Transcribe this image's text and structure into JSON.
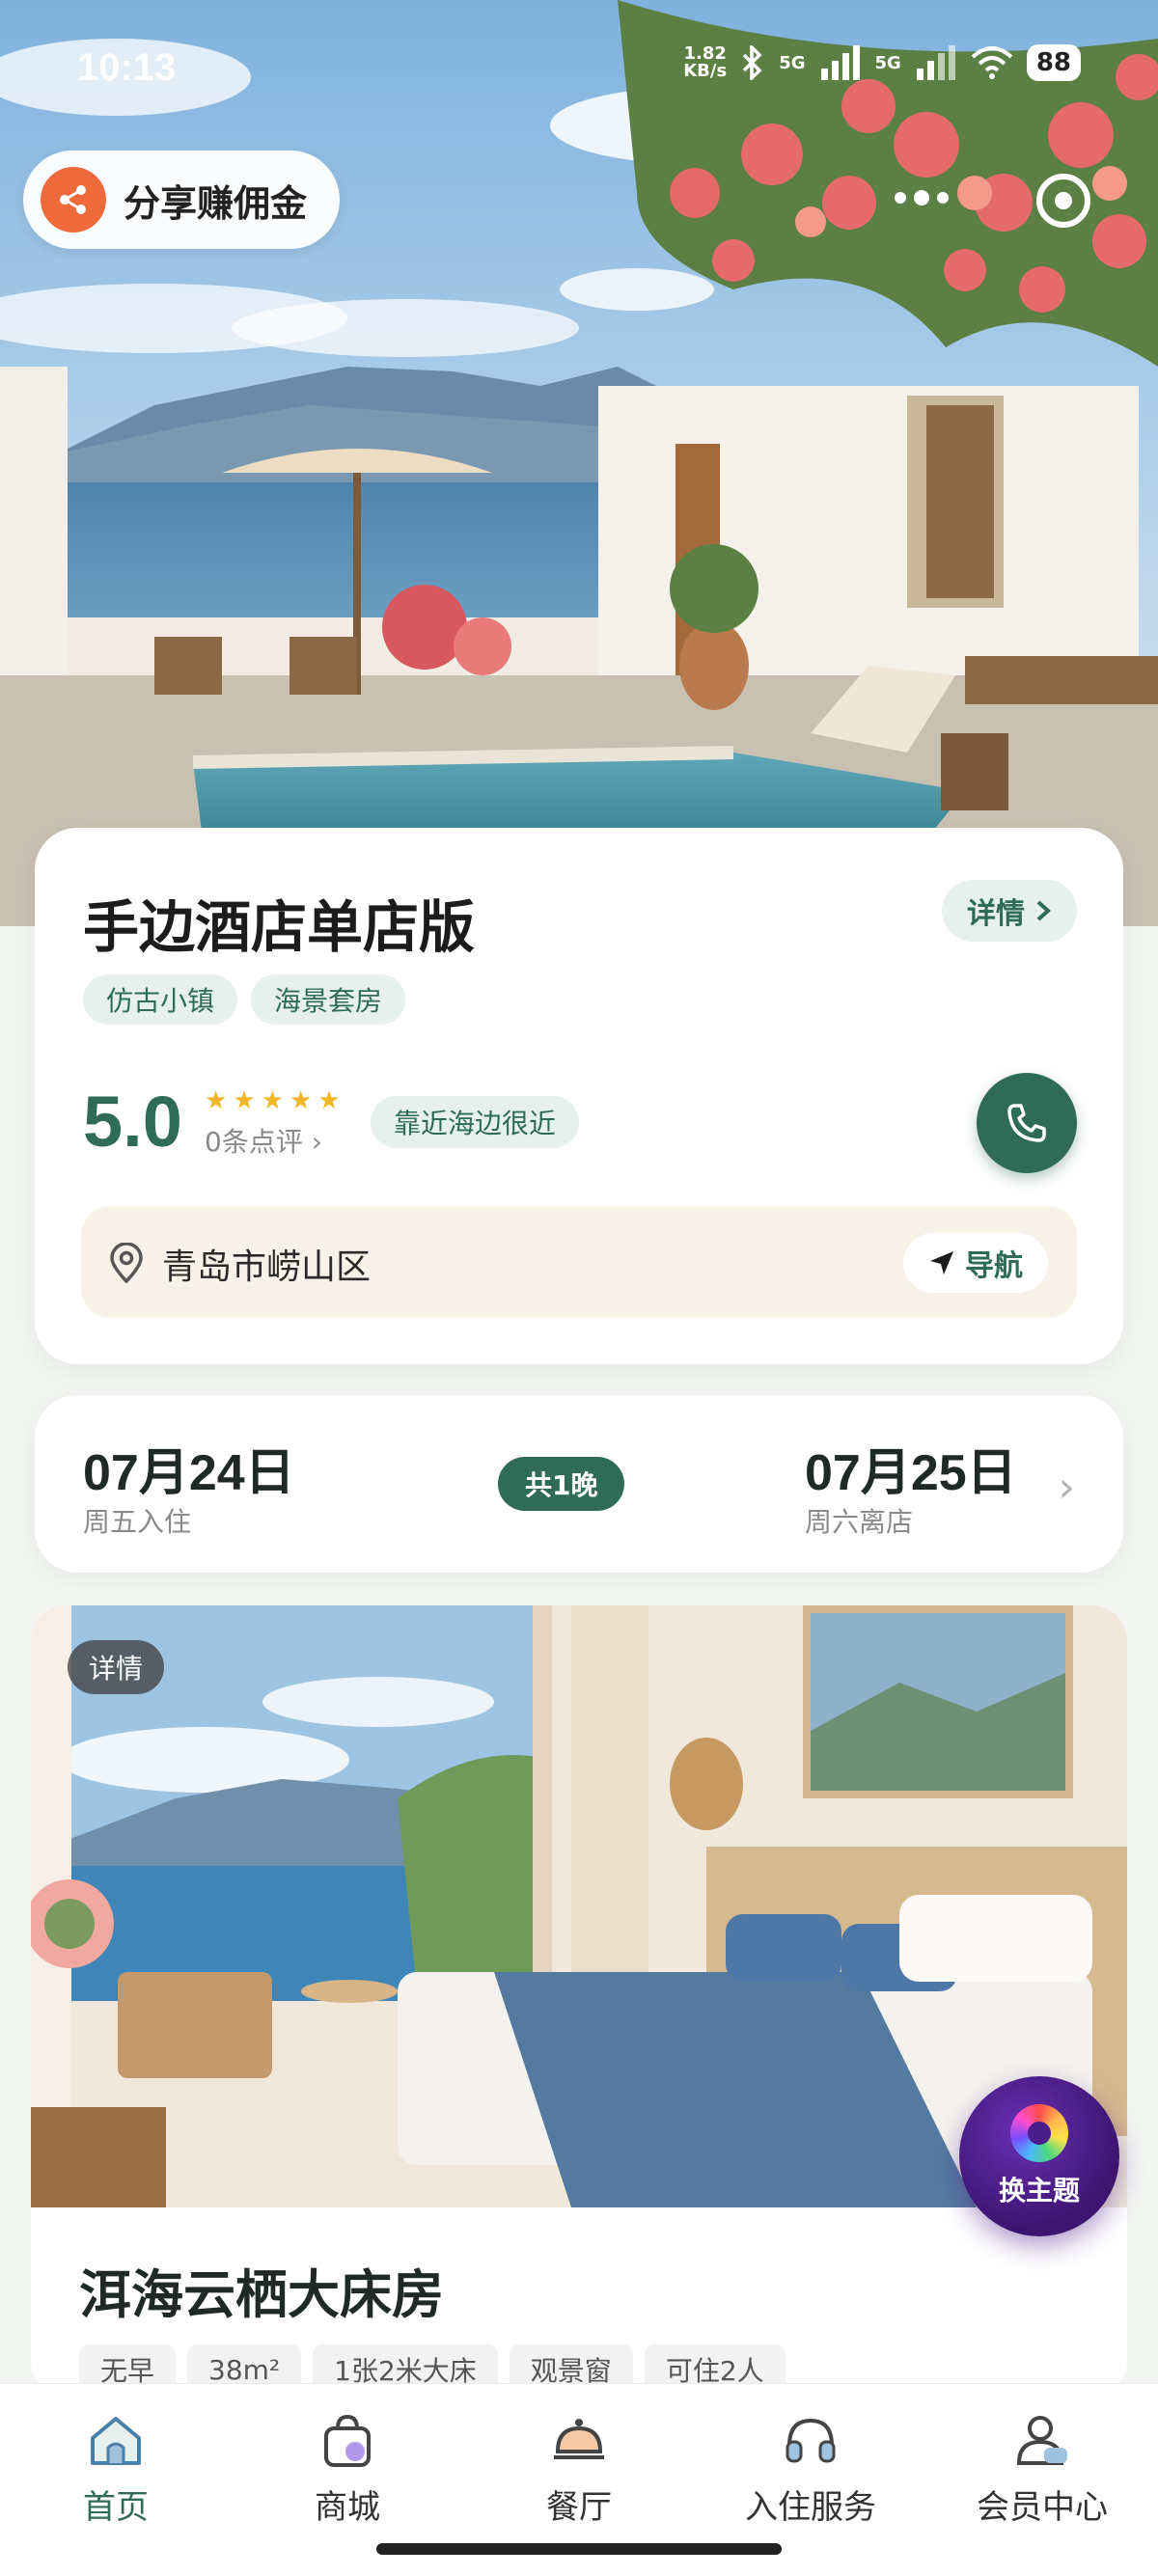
{
  "status_bar": {
    "time": "10:13",
    "speed_value": "1.82",
    "speed_unit": "KB/s",
    "net1": "5G",
    "net2": "5G",
    "battery": "88"
  },
  "header": {
    "share_label": "分享赚佣金",
    "share_icon": "share-icon",
    "more_icon": "more-dots-icon",
    "target_icon": "target-icon"
  },
  "hotel": {
    "name": "手边酒店单店版",
    "detail_label": "详情",
    "tags": [
      "仿古小镇",
      "海景套房"
    ],
    "rating": "5.0",
    "stars": 5,
    "review_count": "0条点评",
    "nearby_tag": "靠近海边很近",
    "address": "青岛市崂山区",
    "nav_label": "导航",
    "accent_color": "#2f6b57"
  },
  "booking": {
    "check_in_date": "07月24日",
    "check_in_label": "周五入住",
    "nights": "共1晚",
    "check_out_date": "07月25日",
    "check_out_label": "周六离店"
  },
  "room": {
    "detail_label": "详情",
    "name": "洱海云栖大床房",
    "tags": [
      "无早",
      "38m²",
      "1张2米大床",
      "观景窗",
      "可住2人"
    ]
  },
  "theme_button": {
    "label": "换主题"
  },
  "bottom_nav": {
    "items": [
      {
        "label": "首页",
        "icon": "home-icon",
        "active": true
      },
      {
        "label": "商城",
        "icon": "shop-bag-icon",
        "active": false
      },
      {
        "label": "餐厅",
        "icon": "dining-bell-icon",
        "active": false
      },
      {
        "label": "入住服务",
        "icon": "headset-icon",
        "active": false
      },
      {
        "label": "会员中心",
        "icon": "member-icon",
        "active": false
      }
    ]
  }
}
